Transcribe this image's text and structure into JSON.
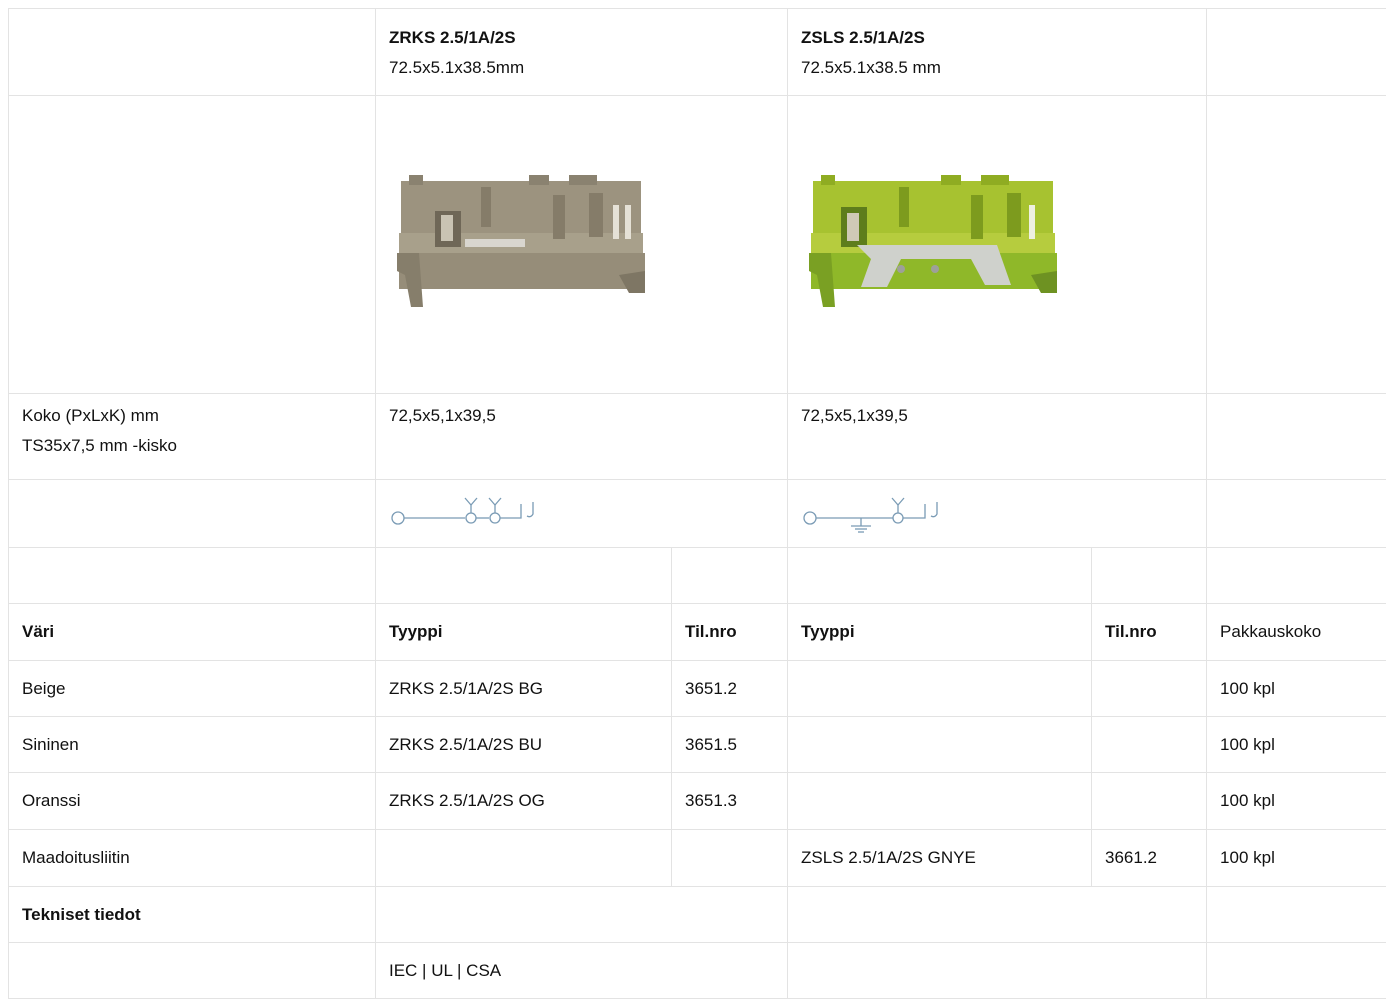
{
  "products": [
    {
      "name": "ZRKS 2.5/1A/2S",
      "dims": "72.5x5.1x38.5mm",
      "color_body": "#9c937f",
      "color_dark": "#6f6757"
    },
    {
      "name": "ZSLS 2.5/1A/2S",
      "dims": "72.5x5.1x38.5 mm",
      "color_body": "#a7c230",
      "color_dark": "#5e7d1c"
    }
  ],
  "size_row": {
    "label_line1": "Koko (PxLxK) mm",
    "label_line2": "TS35x7,5 mm -kisko",
    "value_1": "72,5x5,1x39,5",
    "value_2": "72,5x5,1x39,5"
  },
  "diagram_color": "#7a9bb5",
  "header": {
    "color": "Väri",
    "type_1": "Tyyppi",
    "order_1": "Til.nro",
    "type_2": "Tyyppi",
    "order_2": "Til.nro",
    "pack": "Pakkauskoko"
  },
  "rows": [
    {
      "color": "Beige",
      "type_1": "ZRKS 2.5/1A/2S BG",
      "order_1": "3651.2",
      "type_2": "",
      "order_2": "",
      "pack": "100 kpl"
    },
    {
      "color": "Sininen",
      "type_1": "ZRKS 2.5/1A/2S BU",
      "order_1": "3651.5",
      "type_2": "",
      "order_2": "",
      "pack": "100 kpl"
    },
    {
      "color": "Oranssi",
      "type_1": "ZRKS 2.5/1A/2S OG",
      "order_1": "3651.3",
      "type_2": "",
      "order_2": "",
      "pack": "100 kpl"
    },
    {
      "color": "Maadoitusliitin",
      "type_1": "",
      "order_1": "",
      "type_2": "ZSLS 2.5/1A/2S GNYE",
      "order_2": "3661.2",
      "pack": "100 kpl"
    }
  ],
  "tech": {
    "title": "Tekniset tiedot",
    "approvals": "IEC | UL | CSA"
  }
}
